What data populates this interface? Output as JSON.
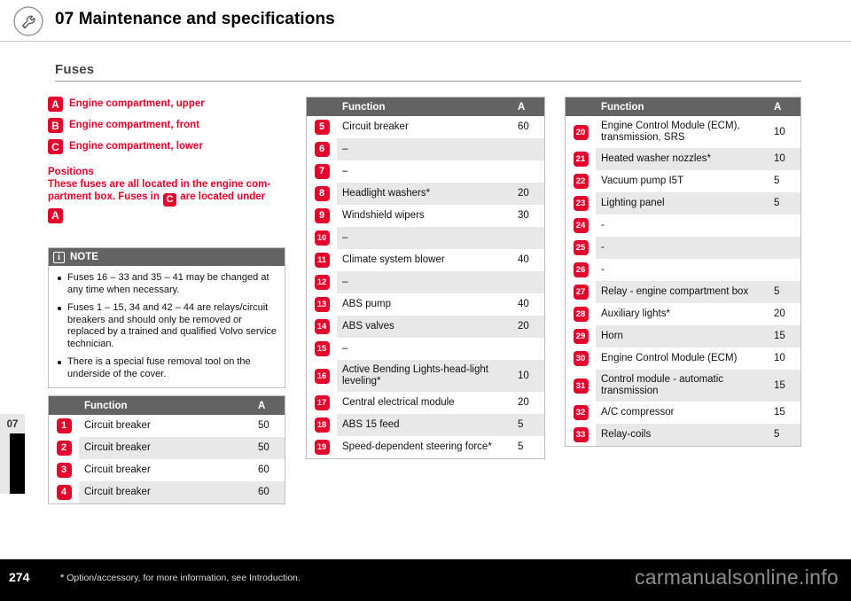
{
  "header": {
    "title": "07 Maintenance and specifications",
    "icon": "wrench-spanner-icon"
  },
  "section": {
    "title": "Fuses"
  },
  "legend": [
    {
      "badge": "A",
      "label": "Engine compartment, upper"
    },
    {
      "badge": "B",
      "label": "Engine compartment, front"
    },
    {
      "badge": "C",
      "label": "Engine compartment, lower"
    }
  ],
  "positions": {
    "heading": "Positions",
    "text_part1": "These fuses are all located in the engine com-",
    "text_part2": "partment box. Fuses in",
    "text_part3": "are located under",
    "inline_badge": "C",
    "below_badge": "A"
  },
  "note": {
    "title": "NOTE",
    "items": [
      "Fuses 16 – 33 and 35 – 41 may be changed at any time when necessary.",
      "Fuses 1 – 15, 34 and 42 – 44 are relays/circuit breakers and should only be removed or replaced by a trained and qualified Volvo service technician.",
      "There is a special fuse removal tool on the underside of the cover."
    ]
  },
  "tables": {
    "headers": {
      "number": "",
      "function": "Function",
      "amps": "A"
    },
    "left": [
      {
        "no": "1",
        "fn": "Circuit breaker",
        "a": "50"
      },
      {
        "no": "2",
        "fn": "Circuit breaker",
        "a": "50"
      },
      {
        "no": "3",
        "fn": "Circuit breaker",
        "a": "60"
      },
      {
        "no": "4",
        "fn": "Circuit breaker",
        "a": "60"
      }
    ],
    "middle": [
      {
        "no": "5",
        "fn": "Circuit breaker",
        "a": "60"
      },
      {
        "no": "6",
        "fn": "–",
        "a": ""
      },
      {
        "no": "7",
        "fn": "–",
        "a": ""
      },
      {
        "no": "8",
        "fn": "Headlight washers*",
        "a": "20"
      },
      {
        "no": "9",
        "fn": "Windshield wipers",
        "a": "30"
      },
      {
        "no": "10",
        "fn": "–",
        "a": ""
      },
      {
        "no": "11",
        "fn": "Climate system blower",
        "a": "40"
      },
      {
        "no": "12",
        "fn": "–",
        "a": ""
      },
      {
        "no": "13",
        "fn": "ABS pump",
        "a": "40"
      },
      {
        "no": "14",
        "fn": "ABS valves",
        "a": "20"
      },
      {
        "no": "15",
        "fn": "–",
        "a": ""
      },
      {
        "no": "16",
        "fn": "Active Bending Lights-head-light leveling*",
        "a": "10"
      },
      {
        "no": "17",
        "fn": "Central electrical module",
        "a": "20"
      },
      {
        "no": "18",
        "fn": "ABS 15 feed",
        "a": "5"
      },
      {
        "no": "19",
        "fn": "Speed-dependent steering force*",
        "a": "5"
      }
    ],
    "right": [
      {
        "no": "20",
        "fn": "Engine Control Module (ECM), transmission, SRS",
        "a": "10"
      },
      {
        "no": "21",
        "fn": "Heated washer nozzles*",
        "a": "10"
      },
      {
        "no": "22",
        "fn": "Vacuum pump I5T",
        "a": "5"
      },
      {
        "no": "23",
        "fn": "Lighting panel",
        "a": "5"
      },
      {
        "no": "24",
        "fn": "-",
        "a": ""
      },
      {
        "no": "25",
        "fn": "-",
        "a": ""
      },
      {
        "no": "26",
        "fn": "-",
        "a": ""
      },
      {
        "no": "27",
        "fn": "Relay - engine compartment box",
        "a": "5"
      },
      {
        "no": "28",
        "fn": "Auxiliary lights*",
        "a": "20"
      },
      {
        "no": "29",
        "fn": "Horn",
        "a": "15"
      },
      {
        "no": "30",
        "fn": "Engine Control Module (ECM)",
        "a": "10"
      },
      {
        "no": "31",
        "fn": "Control module - automatic transmission",
        "a": "15"
      },
      {
        "no": "32",
        "fn": "A/C compressor",
        "a": "15"
      },
      {
        "no": "33",
        "fn": "Relay-coils",
        "a": "5"
      }
    ]
  },
  "side_tab": {
    "chapter": "07"
  },
  "footer": {
    "page": "274",
    "star": "*",
    "note": "Option/accessory, for more information, see Introduction.",
    "watermark": "carmanualsonline.info"
  },
  "colors": {
    "accent": "#e4002b",
    "header_bar": "#636363",
    "row_alt": "#e8e8e8"
  }
}
